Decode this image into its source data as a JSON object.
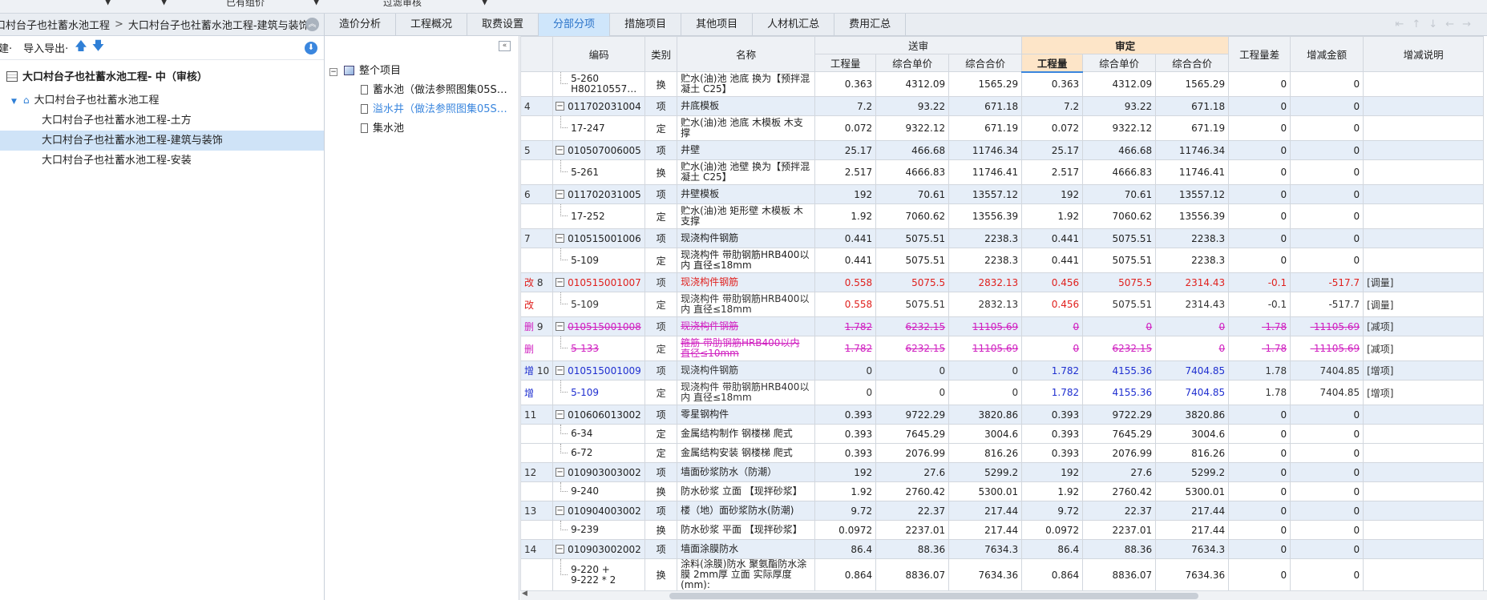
{
  "topbar": {
    "left_text": "已有组价",
    "mid_text": "过滤审核"
  },
  "breadcrumb": {
    "part1": "口村台子也社蓄水池工程",
    "separator": ">",
    "part2": "大口村台子也社蓄水池工程-建筑与装饰"
  },
  "left_toolbar": {
    "new_label": "建·",
    "import_export_label": "导入导出·"
  },
  "left_tree": {
    "root": "大口村台子也社蓄水池工程- 中（审核）",
    "project": "大口村台子也社蓄水池工程",
    "items": [
      "大口村台子也社蓄水池工程-土方",
      "大口村台子也社蓄水池工程-建筑与装饰",
      "大口村台子也社蓄水池工程-安装"
    ]
  },
  "tabs": [
    "造价分析",
    "工程概况",
    "取费设置",
    "分部分项",
    "措施项目",
    "其他项目",
    "人材机汇总",
    "费用汇总"
  ],
  "active_tab": "分部分项",
  "mid_tree": {
    "root": "整个项目",
    "items": [
      "蓄水池（做法参照图集05S…",
      "溢水井（做法参照图集05S…",
      "集水池"
    ]
  },
  "grid": {
    "headers": {
      "code": "编码",
      "type": "类别",
      "name": "名称",
      "sent": "送审",
      "audit": "审定",
      "qty": "工程量",
      "unit_price": "综合单价",
      "total": "综合合价",
      "qty_diff": "工程量差",
      "amount_diff": "增减金额",
      "note": "增减说明"
    },
    "rows": [
      {
        "mark": "",
        "idx": "",
        "code": "5-260\nH80210557…",
        "type": "换",
        "name": "贮水(油)池 池底  换为【预拌混凝土 C25】",
        "sq": "0.363",
        "sp": "4312.09",
        "st": "1565.29",
        "aq": "0.363",
        "ap": "4312.09",
        "at": "1565.29",
        "dq": "0",
        "da": "0",
        "note": "",
        "style": "child"
      },
      {
        "mark": "",
        "idx": "4",
        "code": "011702031004",
        "type": "项",
        "name": "井底模板",
        "sq": "7.2",
        "sp": "93.22",
        "st": "671.18",
        "aq": "7.2",
        "ap": "93.22",
        "at": "671.18",
        "dq": "0",
        "da": "0",
        "note": "",
        "style": "xm"
      },
      {
        "mark": "",
        "idx": "",
        "code": "17-247",
        "type": "定",
        "name": "贮水(油)池 池底 木模板 木支撑",
        "sq": "0.072",
        "sp": "9322.12",
        "st": "671.19",
        "aq": "0.072",
        "ap": "9322.12",
        "at": "671.19",
        "dq": "0",
        "da": "0",
        "note": "",
        "style": "child"
      },
      {
        "mark": "",
        "idx": "5",
        "code": "010507006005",
        "type": "项",
        "name": "井壁",
        "sq": "25.17",
        "sp": "466.68",
        "st": "11746.34",
        "aq": "25.17",
        "ap": "466.68",
        "at": "11746.34",
        "dq": "0",
        "da": "0",
        "note": "",
        "style": "xm"
      },
      {
        "mark": "",
        "idx": "",
        "code": "5-261",
        "type": "换",
        "name": "贮水(油)池 池壁  换为【预拌混凝土 C25】",
        "sq": "2.517",
        "sp": "4666.83",
        "st": "11746.41",
        "aq": "2.517",
        "ap": "4666.83",
        "at": "11746.41",
        "dq": "0",
        "da": "0",
        "note": "",
        "style": "child"
      },
      {
        "mark": "",
        "idx": "6",
        "code": "011702031005",
        "type": "项",
        "name": "井壁模板",
        "sq": "192",
        "sp": "70.61",
        "st": "13557.12",
        "aq": "192",
        "ap": "70.61",
        "at": "13557.12",
        "dq": "0",
        "da": "0",
        "note": "",
        "style": "xm"
      },
      {
        "mark": "",
        "idx": "",
        "code": "17-252",
        "type": "定",
        "name": "贮水(油)池 矩形壁 木模板 木支撑",
        "sq": "1.92",
        "sp": "7060.62",
        "st": "13556.39",
        "aq": "1.92",
        "ap": "7060.62",
        "at": "13556.39",
        "dq": "0",
        "da": "0",
        "note": "",
        "style": "child"
      },
      {
        "mark": "",
        "idx": "7",
        "code": "010515001006",
        "type": "项",
        "name": "现浇构件钢筋",
        "sq": "0.441",
        "sp": "5075.51",
        "st": "2238.3",
        "aq": "0.441",
        "ap": "5075.51",
        "at": "2238.3",
        "dq": "0",
        "da": "0",
        "note": "",
        "style": "xm"
      },
      {
        "mark": "",
        "idx": "",
        "code": "5-109",
        "type": "定",
        "name": "现浇构件 带肋钢筋HRB400以内 直径≤18mm",
        "sq": "0.441",
        "sp": "5075.51",
        "st": "2238.3",
        "aq": "0.441",
        "ap": "5075.51",
        "at": "2238.3",
        "dq": "0",
        "da": "0",
        "note": "",
        "style": "child"
      },
      {
        "mark": "改",
        "idx": "8",
        "code": "010515001007",
        "type": "项",
        "name": "现浇构件钢筋",
        "sq": "0.558",
        "sp": "5075.5",
        "st": "2832.13",
        "aq": "0.456",
        "ap": "5075.5",
        "at": "2314.43",
        "dq": "-0.1",
        "da": "-517.7",
        "note": "[调量]",
        "style": "xm red"
      },
      {
        "mark": "改",
        "idx": "",
        "code": "5-109",
        "type": "定",
        "name": "现浇构件 带肋钢筋HRB400以内 直径≤18mm",
        "sq": "0.558",
        "sp": "5075.51",
        "st": "2832.13",
        "aq": "0.456",
        "ap": "5075.51",
        "at": "2314.43",
        "dq": "-0.1",
        "da": "-517.7",
        "note": "[调量]",
        "style": "child red"
      },
      {
        "mark": "删",
        "idx": "9",
        "code": "010515001008",
        "type": "项",
        "name": "现浇构件钢筋",
        "sq": "1.782",
        "sp": "6232.15",
        "st": "11105.69",
        "aq": "0",
        "ap": "0",
        "at": "0",
        "dq": "-1.78",
        "da": "-11105.69",
        "note": "[减项]",
        "style": "xm del"
      },
      {
        "mark": "删",
        "idx": "",
        "code": "5-133",
        "type": "定",
        "name": "箍筋 带肋钢筋HRB400以内 直径≤10mm",
        "sq": "1.782",
        "sp": "6232.15",
        "st": "11105.69",
        "aq": "0",
        "ap": "6232.15",
        "at": "0",
        "dq": "-1.78",
        "da": "-11105.69",
        "note": "[减项]",
        "style": "child del"
      },
      {
        "mark": "增",
        "idx": "10",
        "code": "010515001009",
        "type": "项",
        "name": "现浇构件钢筋",
        "sq": "0",
        "sp": "0",
        "st": "0",
        "aq": "1.782",
        "ap": "4155.36",
        "at": "7404.85",
        "dq": "1.78",
        "da": "7404.85",
        "note": "[增项]",
        "style": "xm add"
      },
      {
        "mark": "增",
        "idx": "",
        "code": "5-109",
        "type": "定",
        "name": "现浇构件 带肋钢筋HRB400以内 直径≤18mm",
        "sq": "0",
        "sp": "0",
        "st": "0",
        "aq": "1.782",
        "ap": "4155.36",
        "at": "7404.85",
        "dq": "1.78",
        "da": "7404.85",
        "note": "[增项]",
        "style": "child add"
      },
      {
        "mark": "",
        "idx": "11",
        "code": "010606013002",
        "type": "项",
        "name": "零星钢构件",
        "sq": "0.393",
        "sp": "9722.29",
        "st": "3820.86",
        "aq": "0.393",
        "ap": "9722.29",
        "at": "3820.86",
        "dq": "0",
        "da": "0",
        "note": "",
        "style": "xm"
      },
      {
        "mark": "",
        "idx": "",
        "code": "6-34",
        "type": "定",
        "name": "金属结构制作 钢楼梯 爬式",
        "sq": "0.393",
        "sp": "7645.29",
        "st": "3004.6",
        "aq": "0.393",
        "ap": "7645.29",
        "at": "3004.6",
        "dq": "0",
        "da": "0",
        "note": "",
        "style": "child short"
      },
      {
        "mark": "",
        "idx": "",
        "code": "6-72",
        "type": "定",
        "name": "金属结构安装 钢楼梯 爬式",
        "sq": "0.393",
        "sp": "2076.99",
        "st": "816.26",
        "aq": "0.393",
        "ap": "2076.99",
        "at": "816.26",
        "dq": "0",
        "da": "0",
        "note": "",
        "style": "child short"
      },
      {
        "mark": "",
        "idx": "12",
        "code": "010903003002",
        "type": "项",
        "name": "墙面砂浆防水（防潮）",
        "sq": "192",
        "sp": "27.6",
        "st": "5299.2",
        "aq": "192",
        "ap": "27.6",
        "at": "5299.2",
        "dq": "0",
        "da": "0",
        "note": "",
        "style": "xm"
      },
      {
        "mark": "",
        "idx": "",
        "code": "9-240",
        "type": "换",
        "name": "防水砂浆 立面  【现拌砂浆】",
        "sq": "1.92",
        "sp": "2760.42",
        "st": "5300.01",
        "aq": "1.92",
        "ap": "2760.42",
        "at": "5300.01",
        "dq": "0",
        "da": "0",
        "note": "",
        "style": "child short"
      },
      {
        "mark": "",
        "idx": "13",
        "code": "010904003002",
        "type": "项",
        "name": "楼（地）面砂浆防水(防潮)",
        "sq": "9.72",
        "sp": "22.37",
        "st": "217.44",
        "aq": "9.72",
        "ap": "22.37",
        "at": "217.44",
        "dq": "0",
        "da": "0",
        "note": "",
        "style": "xm"
      },
      {
        "mark": "",
        "idx": "",
        "code": "9-239",
        "type": "换",
        "name": "防水砂浆 平面  【现拌砂浆】",
        "sq": "0.0972",
        "sp": "2237.01",
        "st": "217.44",
        "aq": "0.0972",
        "ap": "2237.01",
        "at": "217.44",
        "dq": "0",
        "da": "0",
        "note": "",
        "style": "child short"
      },
      {
        "mark": "",
        "idx": "14",
        "code": "010903002002",
        "type": "项",
        "name": "墙面涂膜防水",
        "sq": "86.4",
        "sp": "88.36",
        "st": "7634.3",
        "aq": "86.4",
        "ap": "88.36",
        "at": "7634.3",
        "dq": "0",
        "da": "0",
        "note": "",
        "style": "xm"
      },
      {
        "mark": "",
        "idx": "",
        "code": "9-220 +\n9-222 * 2",
        "type": "换",
        "name": "涂料(涂膜)防水 聚氨酯防水涂膜 2mm厚 立面  实际厚度(mm):",
        "sq": "0.864",
        "sp": "8836.07",
        "st": "7634.36",
        "aq": "0.864",
        "ap": "8836.07",
        "at": "7634.36",
        "dq": "0",
        "da": "0",
        "note": "",
        "style": "child"
      }
    ]
  }
}
